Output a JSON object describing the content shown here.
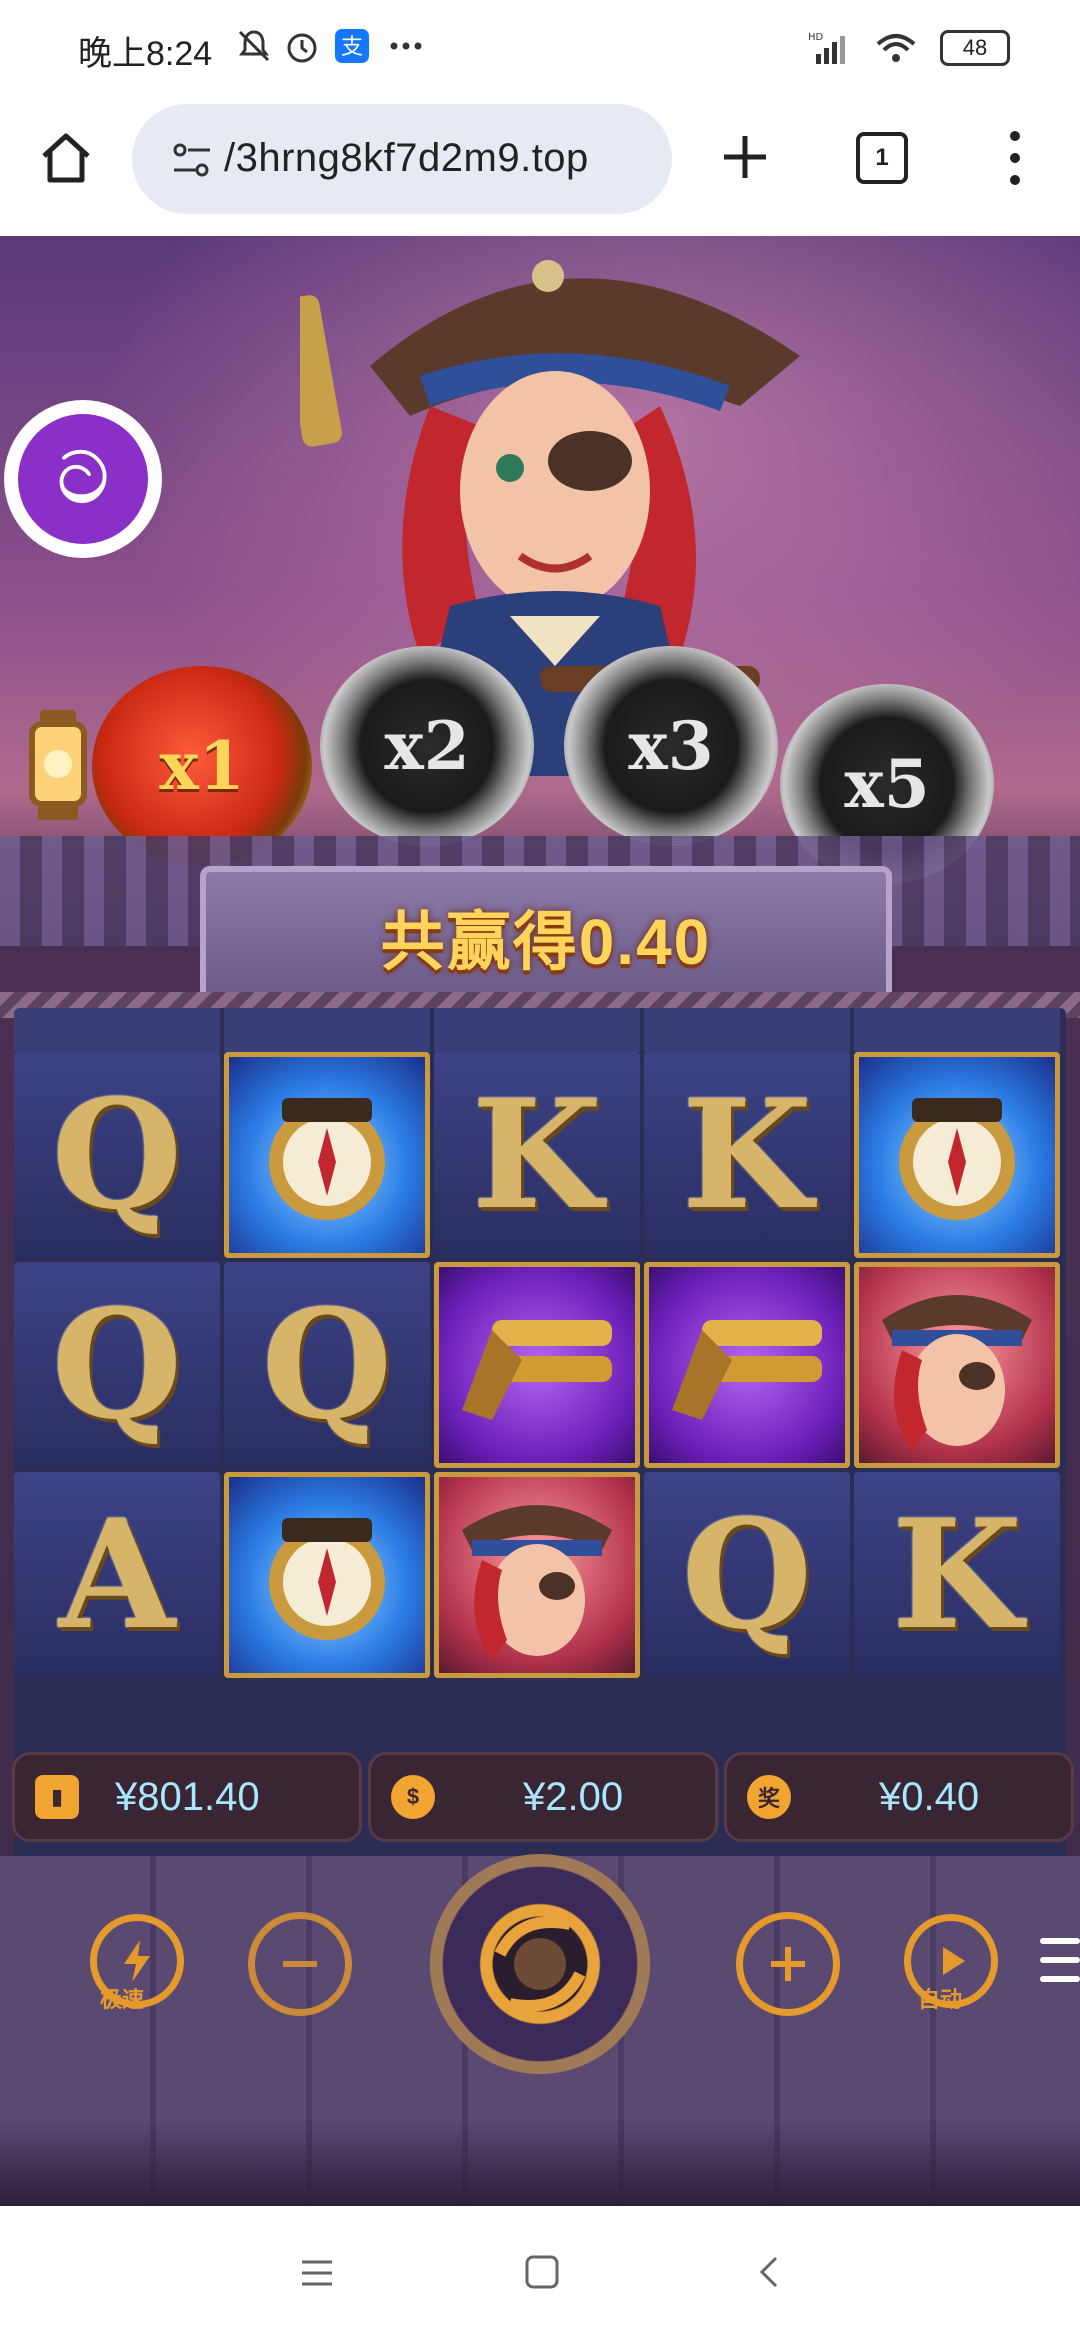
{
  "status_bar": {
    "time": "晚上8:24",
    "icons": [
      "mute-bell-icon",
      "alarm-icon",
      "alipay-icon",
      "more-dots-icon"
    ],
    "network": "HD",
    "battery": "48"
  },
  "browser": {
    "url": "/3hrng8kf7d2m9.top",
    "tab_count": "1",
    "icons": [
      "home-icon",
      "site-settings-icon",
      "new-tab-icon",
      "menu-icon"
    ]
  },
  "game": {
    "multipliers": [
      "x1",
      "x2",
      "x3",
      "x5"
    ],
    "win_banner": "共赢得0.40",
    "reels": [
      [
        "Q",
        "compass",
        "K",
        "K",
        "compass"
      ],
      [
        "Q",
        "Q",
        "pistol",
        "pistol",
        "pirate"
      ],
      [
        "A",
        "compass",
        "pirate",
        "Q",
        "K"
      ]
    ],
    "balance": "¥801.40",
    "bet": "¥2.00",
    "win": "¥0.40",
    "win_icon_label": "奖",
    "controls": {
      "turbo_label": "极速",
      "auto_label": "自动"
    }
  },
  "colors": {
    "accent_gold": "#ffd45a",
    "value_blue": "#a7e7ff",
    "control_orange": "#e69a2c"
  }
}
